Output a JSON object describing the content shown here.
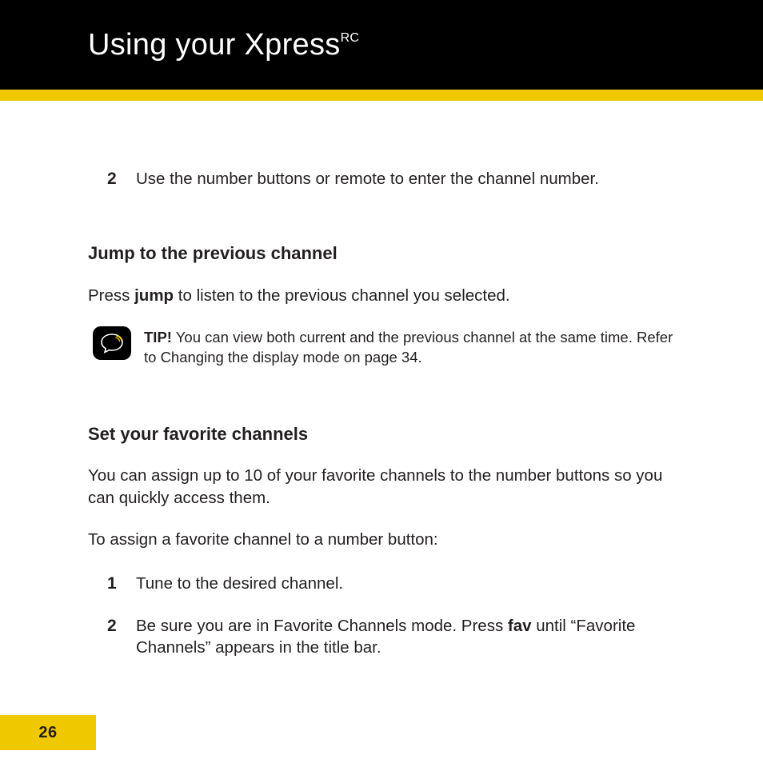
{
  "header": {
    "title_main": "Using your Xpress",
    "title_sup": "RC"
  },
  "top_step": {
    "num": "2",
    "text": "Use the number buttons or remote to enter the channel number."
  },
  "section_jump": {
    "heading": "Jump to the previous channel",
    "para_pre": "Press ",
    "para_bold": "jump",
    "para_post": " to listen to the previous channel you selected.",
    "tip_label": "TIP!",
    "tip_text": " You can view both current and the previous channel at the same time. Refer to Changing the display mode on page 34."
  },
  "section_fav": {
    "heading": "Set your favorite channels",
    "para1": "You can assign up to 10 of your favorite channels to the number buttons so you can quickly access them.",
    "para2": "To assign a favorite channel to a number button:",
    "steps": [
      {
        "num": "1",
        "text": "Tune to the desired channel."
      },
      {
        "num": "2",
        "pre": "Be sure you are in Favorite Channels mode.  Press ",
        "bold": "fav",
        "post": " until “Favorite Channels” appears in the title bar."
      }
    ]
  },
  "footer": {
    "page_number": "26"
  }
}
